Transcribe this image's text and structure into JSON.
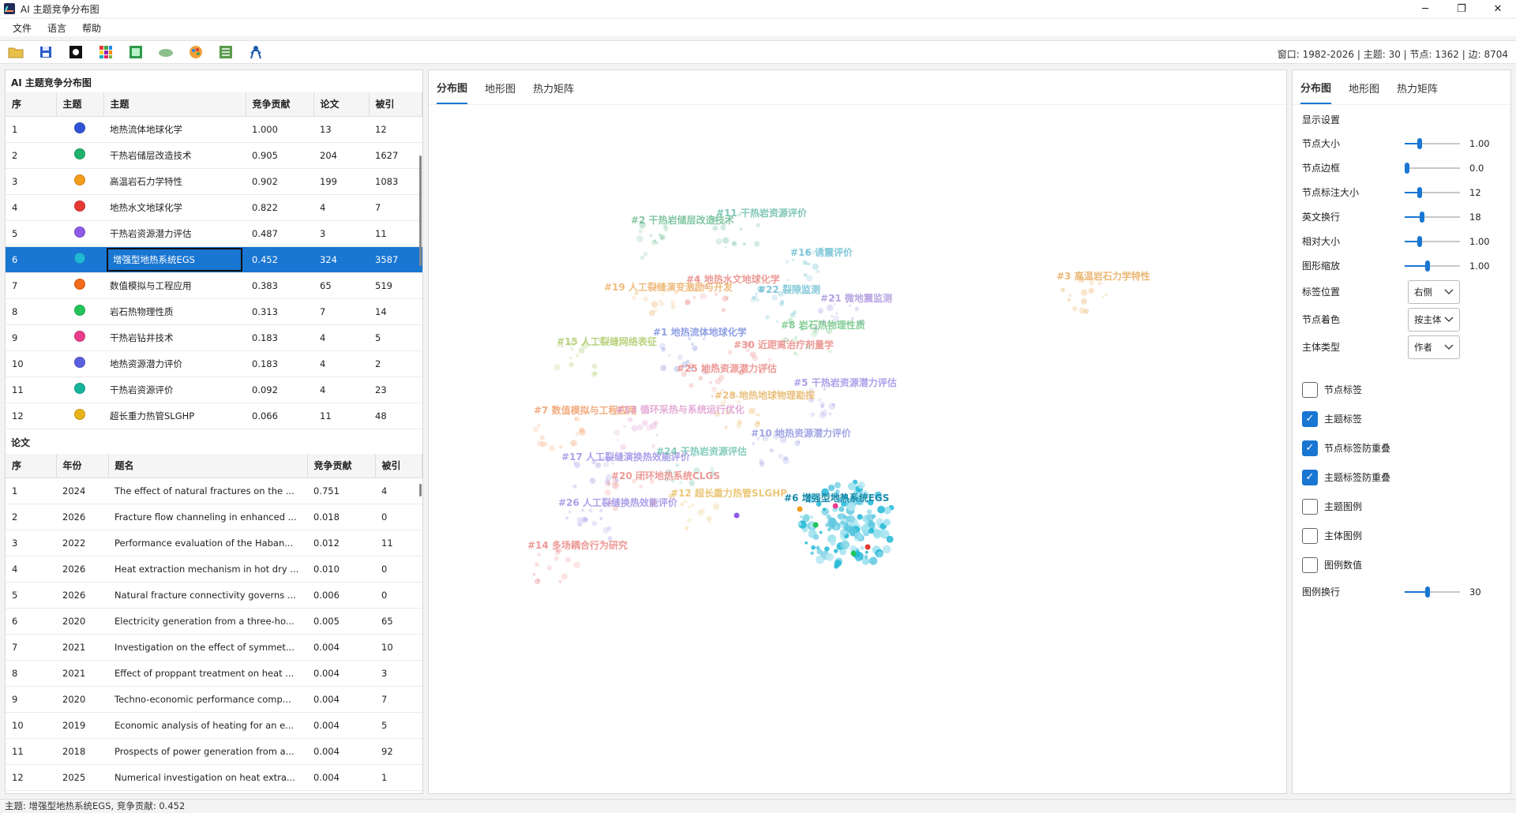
{
  "window": {
    "title": "AI 主题竞争分布图",
    "controls": [
      "─",
      "❐",
      "✕"
    ]
  },
  "menu": [
    "文件",
    "语言",
    "帮助"
  ],
  "toolbar": {
    "icons": [
      "open-folder-icon",
      "save-icon",
      "dark-mode-icon",
      "color-grid-icon",
      "export-image-icon",
      "cloud-icon",
      "palette-icon",
      "network-icon",
      "person-icon"
    ],
    "status": "窗口: 1982-2026 | 主题: 30 | 节点: 1362 | 边: 8704"
  },
  "topics": {
    "section_title": "AI 主题竞争分布图",
    "columns": [
      "序",
      "主题",
      "主题",
      "竞争贡献",
      "论文",
      "被引"
    ],
    "rows": [
      {
        "idx": "1",
        "color": "#2f54d6",
        "name": "地热流体地球化学",
        "score": "1.000",
        "papers": "13",
        "cites": "12"
      },
      {
        "idx": "2",
        "color": "#1fb26b",
        "name": "干热岩储层改造技术",
        "score": "0.905",
        "papers": "204",
        "cites": "1627"
      },
      {
        "idx": "3",
        "color": "#f39c1b",
        "name": "高温岩石力学特性",
        "score": "0.902",
        "papers": "199",
        "cites": "1083"
      },
      {
        "idx": "4",
        "color": "#e53935",
        "name": "地热水文地球化学",
        "score": "0.822",
        "papers": "4",
        "cites": "7"
      },
      {
        "idx": "5",
        "color": "#8e5be8",
        "name": "干热岩资源潜力评估",
        "score": "0.487",
        "papers": "3",
        "cites": "11"
      },
      {
        "idx": "6",
        "color": "#1fb9d6",
        "name": "增强型地热系统EGS",
        "score": "0.452",
        "papers": "324",
        "cites": "3587"
      },
      {
        "idx": "7",
        "color": "#f26a1b",
        "name": "数值模拟与工程应用",
        "score": "0.383",
        "papers": "65",
        "cites": "519"
      },
      {
        "idx": "8",
        "color": "#23c45a",
        "name": "岩石热物理性质",
        "score": "0.313",
        "papers": "7",
        "cites": "14"
      },
      {
        "idx": "9",
        "color": "#e83e8c",
        "name": "干热岩钻井技术",
        "score": "0.183",
        "papers": "4",
        "cites": "5"
      },
      {
        "idx": "10",
        "color": "#5a5fe0",
        "name": "地热资源潜力评价",
        "score": "0.183",
        "papers": "4",
        "cites": "2"
      },
      {
        "idx": "11",
        "color": "#16b39a",
        "name": "干热岩资源评价",
        "score": "0.092",
        "papers": "4",
        "cites": "23"
      },
      {
        "idx": "12",
        "color": "#e8b21b",
        "name": "超长重力热管SLGHP",
        "score": "0.066",
        "papers": "11",
        "cites": "48"
      }
    ],
    "selected_index": 5
  },
  "papers": {
    "section_title": "论文",
    "columns": [
      "序",
      "年份",
      "题名",
      "竞争贡献",
      "被引"
    ],
    "rows": [
      {
        "idx": "1",
        "year": "2024",
        "title": "The effect of natural fractures on the ...",
        "score": "0.751",
        "cites": "4"
      },
      {
        "idx": "2",
        "year": "2026",
        "title": "Fracture flow channeling in enhanced ...",
        "score": "0.018",
        "cites": "0"
      },
      {
        "idx": "3",
        "year": "2022",
        "title": "Performance evaluation of the Haban...",
        "score": "0.012",
        "cites": "11"
      },
      {
        "idx": "4",
        "year": "2026",
        "title": "Heat extraction mechanism in hot dry ...",
        "score": "0.010",
        "cites": "0"
      },
      {
        "idx": "5",
        "year": "2026",
        "title": "Natural fracture connectivity governs ...",
        "score": "0.006",
        "cites": "0"
      },
      {
        "idx": "6",
        "year": "2020",
        "title": "Electricity generation from a three-ho...",
        "score": "0.005",
        "cites": "65"
      },
      {
        "idx": "7",
        "year": "2021",
        "title": "Investigation on the effect of symmet...",
        "score": "0.004",
        "cites": "10"
      },
      {
        "idx": "8",
        "year": "2021",
        "title": "Effect of proppant treatment on heat ...",
        "score": "0.004",
        "cites": "3"
      },
      {
        "idx": "9",
        "year": "2020",
        "title": "Techno-economic performance comp...",
        "score": "0.004",
        "cites": "7"
      },
      {
        "idx": "10",
        "year": "2019",
        "title": "Economic analysis of heating for an e...",
        "score": "0.004",
        "cites": "5"
      },
      {
        "idx": "11",
        "year": "2018",
        "title": "Prospects of power generation from a...",
        "score": "0.004",
        "cites": "92"
      },
      {
        "idx": "12",
        "year": "2025",
        "title": "Numerical investigation on heat extra...",
        "score": "0.004",
        "cites": "1"
      }
    ]
  },
  "center_tabs": [
    "分布图",
    "地形图",
    "热力矩阵"
  ],
  "map": {
    "clusters": [
      {
        "label": "#2 干热岩储层改造技术",
        "color": "#4caf7a"
      },
      {
        "label": "#11 干热岩资源评价",
        "color": "#4caf9a"
      },
      {
        "label": "#16 诱震评价",
        "color": "#4ab0c8"
      },
      {
        "label": "#3 高温岩石力学特性",
        "color": "#e39a3a"
      },
      {
        "label": "#4 地热水文地球化学",
        "color": "#e5706a"
      },
      {
        "label": "#19 人工裂缝演变激励与开发",
        "color": "#e8a14a"
      },
      {
        "label": "#22 裂隙监测",
        "color": "#4ab0c8"
      },
      {
        "label": "#21 微地震监测",
        "color": "#9a7fd6"
      },
      {
        "label": "#8 岩石热物理性质",
        "color": "#52b86a"
      },
      {
        "label": "#15 人工裂缝网络表征",
        "color": "#9ac048"
      },
      {
        "label": "#1 地热流体地球化学",
        "color": "#6078d8"
      },
      {
        "label": "#30 近距离治疗剂量学",
        "color": "#e5706a"
      },
      {
        "label": "#25 地热资源潜力评估",
        "color": "#e5706a"
      },
      {
        "label": "#5 干热岩资源潜力评估",
        "color": "#8a78e0"
      },
      {
        "label": "#28 地热地球物理勘探",
        "color": "#e3a84a"
      },
      {
        "label": "#7 数值模拟与工程应用",
        "color": "#ef8a4a"
      },
      {
        "label": "#13 循环采热与系统运行优化",
        "color": "#d88ac8"
      },
      {
        "label": "#10 地热资源潜力评价",
        "color": "#7a7fd8"
      },
      {
        "label": "#17 人工裂缝演换热效能评价",
        "color": "#8a78e0"
      },
      {
        "label": "#24 干热岩资源评估",
        "color": "#52b8a0"
      },
      {
        "label": "#20 闭环地热系统CLGS",
        "color": "#e5706a"
      },
      {
        "label": "#12 超长重力热管SLGHP",
        "color": "#e3b040"
      },
      {
        "label": "#6 增强型地热系统EGS",
        "color": "#1a8aa8"
      },
      {
        "label": "#26 人工裂缝换热效能评价",
        "color": "#8a78e0"
      },
      {
        "label": "#14 多场耦合行为研究",
        "color": "#e5706a"
      }
    ]
  },
  "right_tabs": [
    "分布图",
    "地形图",
    "热力矩阵"
  ],
  "settings": {
    "section_title": "显示设置",
    "sliders": [
      {
        "label": "节点大小",
        "value": "1.00",
        "pos": 0.25
      },
      {
        "label": "节点边框",
        "value": "0.0",
        "pos": 0.0
      },
      {
        "label": "节点标注大小",
        "value": "12",
        "pos": 0.25
      },
      {
        "label": "英文换行",
        "value": "18",
        "pos": 0.3
      },
      {
        "label": "相对大小",
        "value": "1.00",
        "pos": 0.25
      },
      {
        "label": "图形缩放",
        "value": "1.00",
        "pos": 0.4
      }
    ],
    "combos": [
      {
        "label": "标签位置",
        "value": "右侧"
      },
      {
        "label": "节点着色",
        "value": "按主体"
      },
      {
        "label": "主体类型",
        "value": "作者"
      }
    ],
    "checks": [
      {
        "label": "节点标签",
        "checked": false
      },
      {
        "label": "主题标签",
        "checked": true
      },
      {
        "label": "节点标签防重叠",
        "checked": true
      },
      {
        "label": "主题标签防重叠",
        "checked": true
      },
      {
        "label": "主题图例",
        "checked": false
      },
      {
        "label": "主体图例",
        "checked": false
      },
      {
        "label": "图例数值",
        "checked": false
      }
    ],
    "legend_wrap": {
      "label": "图例换行",
      "value": "30",
      "pos": 0.4
    }
  },
  "statusbar": "主题: 增强型地热系统EGS, 竞争贡献: 0.452"
}
